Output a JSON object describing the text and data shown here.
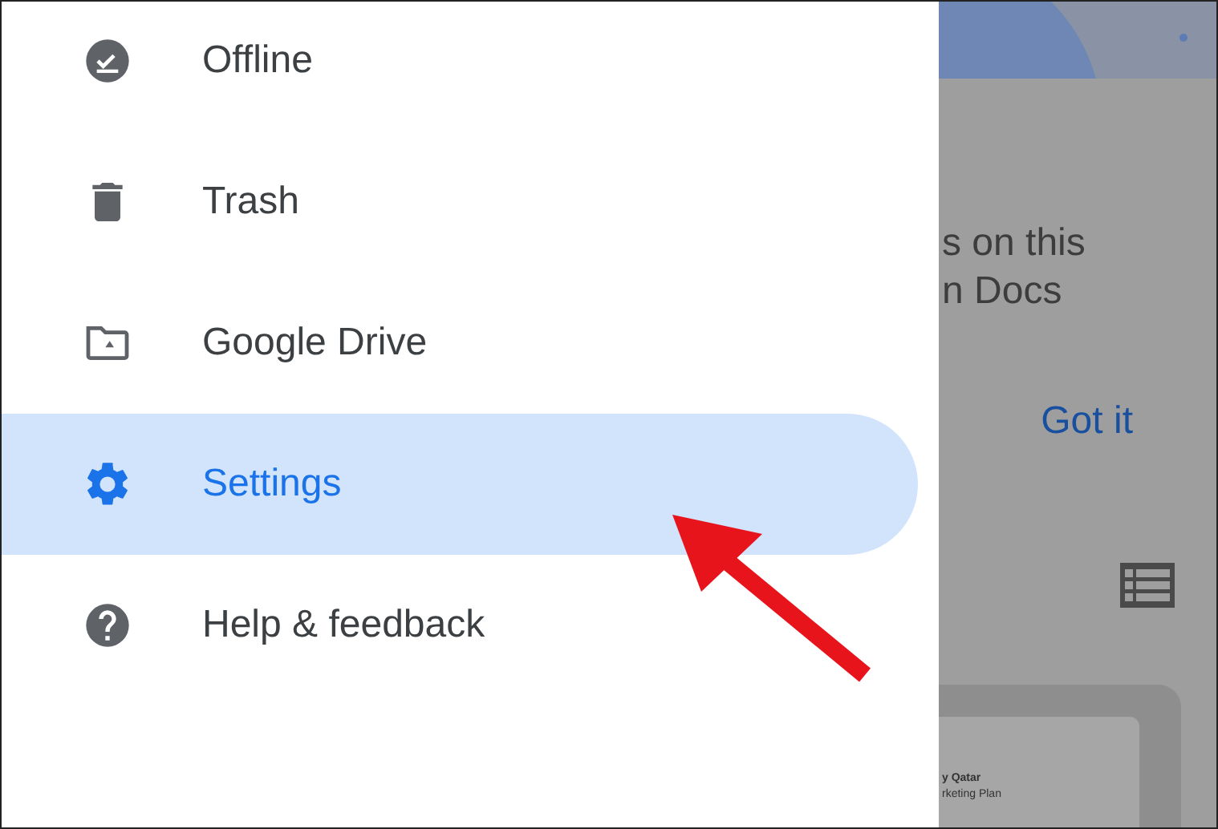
{
  "drawer": {
    "items": [
      {
        "kind": "offline",
        "label": "Offline",
        "selected": false
      },
      {
        "kind": "trash",
        "label": "Trash",
        "selected": false
      },
      {
        "kind": "drive",
        "label": "Google Drive",
        "selected": false
      },
      {
        "kind": "settings",
        "label": "Settings",
        "selected": true
      },
      {
        "kind": "help",
        "label": "Help & feedback",
        "selected": false
      }
    ]
  },
  "background": {
    "banner_lines": [
      "s on this",
      "n Docs"
    ],
    "button": "Got it",
    "card_lines": [
      "y Qatar",
      "rketing Plan"
    ]
  }
}
